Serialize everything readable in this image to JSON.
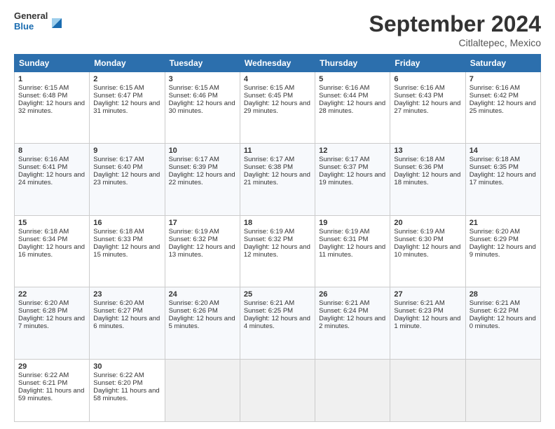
{
  "logo": {
    "general": "General",
    "blue": "Blue"
  },
  "title": "September 2024",
  "location": "Citlaltepec, Mexico",
  "days_header": [
    "Sunday",
    "Monday",
    "Tuesday",
    "Wednesday",
    "Thursday",
    "Friday",
    "Saturday"
  ],
  "weeks": [
    [
      {
        "day": "1",
        "sunrise": "6:15 AM",
        "sunset": "6:48 PM",
        "daylight": "12 hours and 32 minutes."
      },
      {
        "day": "2",
        "sunrise": "6:15 AM",
        "sunset": "6:47 PM",
        "daylight": "12 hours and 31 minutes."
      },
      {
        "day": "3",
        "sunrise": "6:15 AM",
        "sunset": "6:46 PM",
        "daylight": "12 hours and 30 minutes."
      },
      {
        "day": "4",
        "sunrise": "6:15 AM",
        "sunset": "6:45 PM",
        "daylight": "12 hours and 29 minutes."
      },
      {
        "day": "5",
        "sunrise": "6:16 AM",
        "sunset": "6:44 PM",
        "daylight": "12 hours and 28 minutes."
      },
      {
        "day": "6",
        "sunrise": "6:16 AM",
        "sunset": "6:43 PM",
        "daylight": "12 hours and 27 minutes."
      },
      {
        "day": "7",
        "sunrise": "6:16 AM",
        "sunset": "6:42 PM",
        "daylight": "12 hours and 25 minutes."
      }
    ],
    [
      {
        "day": "8",
        "sunrise": "6:16 AM",
        "sunset": "6:41 PM",
        "daylight": "12 hours and 24 minutes."
      },
      {
        "day": "9",
        "sunrise": "6:17 AM",
        "sunset": "6:40 PM",
        "daylight": "12 hours and 23 minutes."
      },
      {
        "day": "10",
        "sunrise": "6:17 AM",
        "sunset": "6:39 PM",
        "daylight": "12 hours and 22 minutes."
      },
      {
        "day": "11",
        "sunrise": "6:17 AM",
        "sunset": "6:38 PM",
        "daylight": "12 hours and 21 minutes."
      },
      {
        "day": "12",
        "sunrise": "6:17 AM",
        "sunset": "6:37 PM",
        "daylight": "12 hours and 19 minutes."
      },
      {
        "day": "13",
        "sunrise": "6:18 AM",
        "sunset": "6:36 PM",
        "daylight": "12 hours and 18 minutes."
      },
      {
        "day": "14",
        "sunrise": "6:18 AM",
        "sunset": "6:35 PM",
        "daylight": "12 hours and 17 minutes."
      }
    ],
    [
      {
        "day": "15",
        "sunrise": "6:18 AM",
        "sunset": "6:34 PM",
        "daylight": "12 hours and 16 minutes."
      },
      {
        "day": "16",
        "sunrise": "6:18 AM",
        "sunset": "6:33 PM",
        "daylight": "12 hours and 15 minutes."
      },
      {
        "day": "17",
        "sunrise": "6:19 AM",
        "sunset": "6:32 PM",
        "daylight": "12 hours and 13 minutes."
      },
      {
        "day": "18",
        "sunrise": "6:19 AM",
        "sunset": "6:32 PM",
        "daylight": "12 hours and 12 minutes."
      },
      {
        "day": "19",
        "sunrise": "6:19 AM",
        "sunset": "6:31 PM",
        "daylight": "12 hours and 11 minutes."
      },
      {
        "day": "20",
        "sunrise": "6:19 AM",
        "sunset": "6:30 PM",
        "daylight": "12 hours and 10 minutes."
      },
      {
        "day": "21",
        "sunrise": "6:20 AM",
        "sunset": "6:29 PM",
        "daylight": "12 hours and 9 minutes."
      }
    ],
    [
      {
        "day": "22",
        "sunrise": "6:20 AM",
        "sunset": "6:28 PM",
        "daylight": "12 hours and 7 minutes."
      },
      {
        "day": "23",
        "sunrise": "6:20 AM",
        "sunset": "6:27 PM",
        "daylight": "12 hours and 6 minutes."
      },
      {
        "day": "24",
        "sunrise": "6:20 AM",
        "sunset": "6:26 PM",
        "daylight": "12 hours and 5 minutes."
      },
      {
        "day": "25",
        "sunrise": "6:21 AM",
        "sunset": "6:25 PM",
        "daylight": "12 hours and 4 minutes."
      },
      {
        "day": "26",
        "sunrise": "6:21 AM",
        "sunset": "6:24 PM",
        "daylight": "12 hours and 2 minutes."
      },
      {
        "day": "27",
        "sunrise": "6:21 AM",
        "sunset": "6:23 PM",
        "daylight": "12 hours and 1 minute."
      },
      {
        "day": "28",
        "sunrise": "6:21 AM",
        "sunset": "6:22 PM",
        "daylight": "12 hours and 0 minutes."
      }
    ],
    [
      {
        "day": "29",
        "sunrise": "6:22 AM",
        "sunset": "6:21 PM",
        "daylight": "11 hours and 59 minutes."
      },
      {
        "day": "30",
        "sunrise": "6:22 AM",
        "sunset": "6:20 PM",
        "daylight": "11 hours and 58 minutes."
      },
      null,
      null,
      null,
      null,
      null
    ]
  ]
}
